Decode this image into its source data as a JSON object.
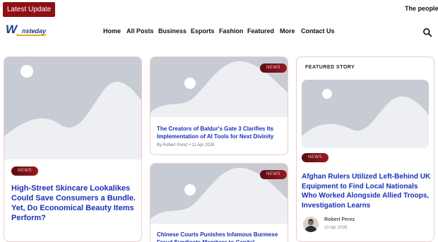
{
  "ticker": {
    "label": "Latest Update",
    "headline": "The people"
  },
  "logo": {
    "first": "W",
    "rest": "nsteday"
  },
  "nav": {
    "items": [
      "Home",
      "All Posts",
      "Business",
      "Esports",
      "Fashion",
      "Featured",
      "More",
      "Contact Us"
    ]
  },
  "cards": [
    {
      "badge": "NEWS",
      "title": "High-Street Skincare Lookalikes Could Save Consumers a Bundle. Yet, Do Economical Beauty Items Perform?"
    },
    {
      "badge": "NEWS",
      "title": "The Creators of Baldur's Gate 3 Clarifies Its Implementation of AI Tools for Next Divinity",
      "author": "By Robert Perez",
      "date": "11 Apr 2026"
    },
    {
      "badge": "NEWS",
      "title": "Chinese Courts Punishes Infamous Burmese Fraud Syndicate Members to Capital"
    }
  ],
  "featured": {
    "label": "FEATURED STORY",
    "badge": "NEWS",
    "title": "Afghan Rulers Utilized Left-Behind UK Equipment to Find Local Nationals Who Worked Alongside Allied Troops, Investigation Learns",
    "author": "Robert Perez",
    "date": "10 Apr 2026"
  }
}
